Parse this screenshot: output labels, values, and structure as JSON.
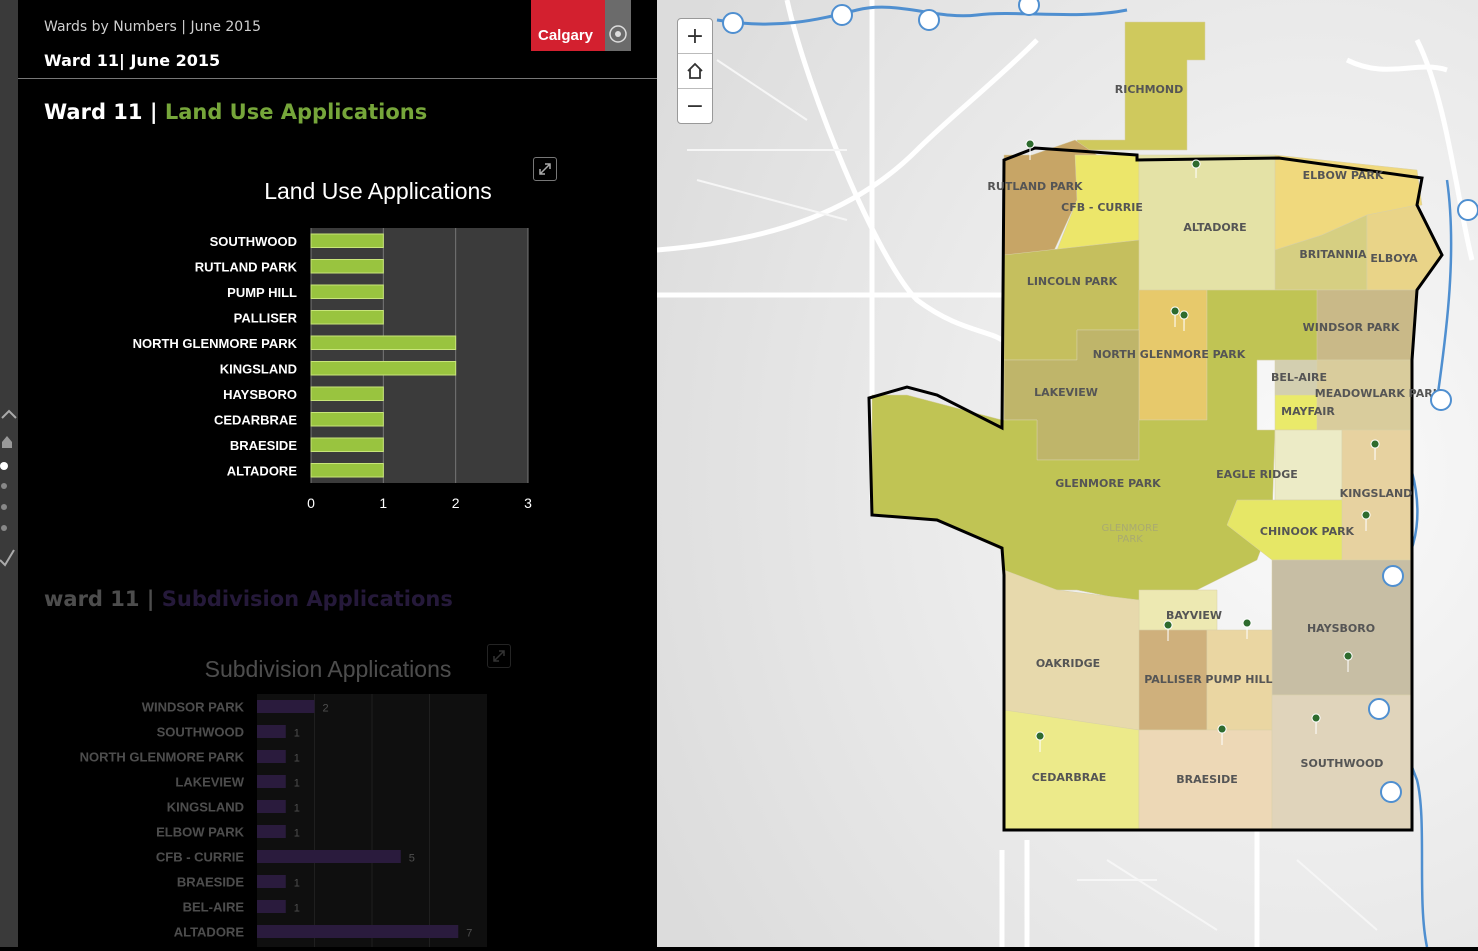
{
  "header": {
    "subtitle": "Wards by Numbers | June 2015",
    "title": "Ward 11| June 2015",
    "logo_text": "Calgary"
  },
  "section1": {
    "prefix": "Ward 11 |",
    "name": "Land Use Applications"
  },
  "section2": {
    "prefix": "ward 11 |",
    "name": "Subdivision Applications"
  },
  "colors": {
    "accent_green": "#76a63a",
    "bar_green": "#99c43f",
    "bar_purple": "#3a2a55",
    "logo_red": "#d3202f",
    "ward_boundary": "#000000"
  },
  "chart_data": [
    {
      "type": "bar",
      "title": "Land Use Applications",
      "categories": [
        "SOUTHWOOD",
        "RUTLAND PARK",
        "PUMP HILL",
        "PALLISER",
        "NORTH GLENMORE PARK",
        "KINGSLAND",
        "HAYSBORO",
        "CEDARBRAE",
        "BRAESIDE",
        "ALTADORE"
      ],
      "values": [
        1,
        1,
        1,
        1,
        2,
        2,
        1,
        1,
        1,
        1
      ],
      "xlim": [
        0,
        3
      ],
      "ticks": [
        0,
        1,
        2,
        3
      ],
      "orientation": "horizontal",
      "grid": true
    },
    {
      "type": "bar",
      "title": "Subdivision Applications",
      "categories": [
        "WINDSOR PARK",
        "SOUTHWOOD",
        "NORTH GLENMORE PARK",
        "LAKEVIEW",
        "KINGSLAND",
        "ELBOW PARK",
        "CFB - CURRIE",
        "BRAESIDE",
        "BEL-AIRE",
        "ALTADORE"
      ],
      "values": [
        2,
        1,
        1,
        1,
        1,
        1,
        5,
        1,
        1,
        7
      ],
      "xlim": [
        0,
        8
      ],
      "orientation": "horizontal",
      "grid": true,
      "data_labels": true
    }
  ],
  "map": {
    "zoom_in": "+",
    "home_icon": "home-icon",
    "zoom_out": "−",
    "neighbourhoods": [
      "RICHMOND",
      "RUTLAND PARK",
      "CFB - CURRIE",
      "ALTADORE",
      "ELBOW PARK",
      "BRITANNIA",
      "ELBOYA",
      "LINCOLN PARK",
      "NORTH GLENMORE PARK",
      "WINDSOR PARK",
      "BEL-AIRE",
      "MEADOWLARK PARK",
      "MAYFAIR",
      "LAKEVIEW",
      "GLENMORE PARK",
      "EAGLE RIDGE",
      "KINGSLAND",
      "CHINOOK PARK",
      "BAYVIEW",
      "HAYSBORO",
      "OAKRIDGE",
      "PALLISER",
      "PUMP HILL",
      "CEDARBRAE",
      "BRAESIDE",
      "SOUTHWOOD"
    ],
    "faint_labels": [
      "GLENMORE",
      "PARK"
    ]
  }
}
